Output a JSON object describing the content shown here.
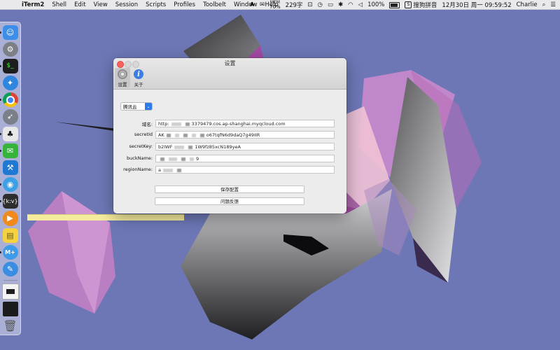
{
  "menubar": {
    "app_name": "iTerm2",
    "menus": [
      "Shell",
      "Edit",
      "View",
      "Session",
      "Scripts",
      "Profiles",
      "Toolbelt",
      "Window",
      "Help"
    ],
    "status": {
      "mem_label": "MEM",
      "mem_value": "70%",
      "char_count": "229字",
      "battery": "100%",
      "input_method": "搜狗拼音",
      "datetime": "12月30日 周一  09:59:52",
      "user": "Charlie"
    }
  },
  "dock": {
    "apps": [
      {
        "name": "finder",
        "color": "#3d8ee8",
        "glyph": "☺"
      },
      {
        "name": "system-preferences",
        "color": "#7d7f86",
        "glyph": "⚙"
      },
      {
        "name": "iterm",
        "color": "#1d1d1d",
        "glyph": "$"
      },
      {
        "name": "safari",
        "color": "#2e86de",
        "glyph": "✦"
      },
      {
        "name": "chrome",
        "color": "#db4437",
        "glyph": "●"
      },
      {
        "name": "rocket",
        "color": "#7b7f8a",
        "glyph": "➶"
      },
      {
        "name": "qq",
        "color": "#111111",
        "glyph": "♣"
      },
      {
        "name": "wechat",
        "color": "#35b33a",
        "glyph": "✉"
      },
      {
        "name": "xcode",
        "color": "#1f78d1",
        "glyph": "⚒"
      },
      {
        "name": "browser",
        "color": "#3ba0e6",
        "glyph": "◉"
      },
      {
        "name": "json-editor",
        "color": "#2d2d2d",
        "glyph": "{}"
      },
      {
        "name": "infuse",
        "color": "#f08a1c",
        "glyph": "▶"
      },
      {
        "name": "stickies",
        "color": "#f5d23e",
        "glyph": "▤"
      },
      {
        "name": "markdown",
        "color": "#3d9be9",
        "glyph": "M"
      },
      {
        "name": "pencil",
        "color": "#3a8de0",
        "glyph": "✎"
      }
    ],
    "extras": [
      "window-thumbnail",
      "terminal-thumbnail",
      "trash"
    ]
  },
  "window": {
    "title": "设置",
    "toolbar": [
      {
        "label": "设置",
        "icon": "gear-icon",
        "active": true
      },
      {
        "label": "关于",
        "icon": "info-icon",
        "active": false
      }
    ],
    "provider": "腾讯云",
    "fields": [
      {
        "label": "域名:",
        "pre": "http:",
        "post": "3379479.cos.ap-shanghai.myqcloud.com"
      },
      {
        "label": "secretId",
        "pre": "AK",
        "post": "o67tqfN6d9daQ7g49IIR"
      },
      {
        "label": "secretKey:",
        "pre": "b2IWF",
        "post": "1W9fz85xcN189yeA"
      },
      {
        "label": "buckName:",
        "pre": "",
        "post": "9"
      },
      {
        "label": "regionName:",
        "pre": "a",
        "post": ""
      }
    ],
    "save_button": "保存配置",
    "feedback_button": "问题反馈"
  }
}
